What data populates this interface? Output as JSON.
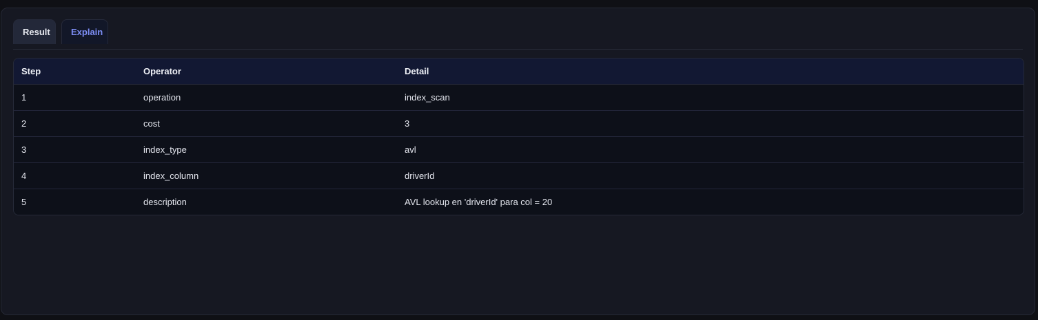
{
  "tabs": [
    {
      "label": "Result",
      "active": false
    },
    {
      "label": "Explain",
      "active": true
    }
  ],
  "table": {
    "headers": [
      "Step",
      "Operator",
      "Detail"
    ],
    "rows": [
      {
        "step": "1",
        "operator": "operation",
        "detail": "index_scan"
      },
      {
        "step": "2",
        "operator": "cost",
        "detail": "3"
      },
      {
        "step": "3",
        "operator": "index_type",
        "detail": "avl"
      },
      {
        "step": "4",
        "operator": "index_column",
        "detail": "driverId"
      },
      {
        "step": "5",
        "operator": "description",
        "detail": "AVL lookup en 'driverId' para col = 20"
      }
    ]
  },
  "colors": {
    "accent": "#7d8ef5",
    "panel_bg": "#161822",
    "header_bg": "#121833"
  }
}
